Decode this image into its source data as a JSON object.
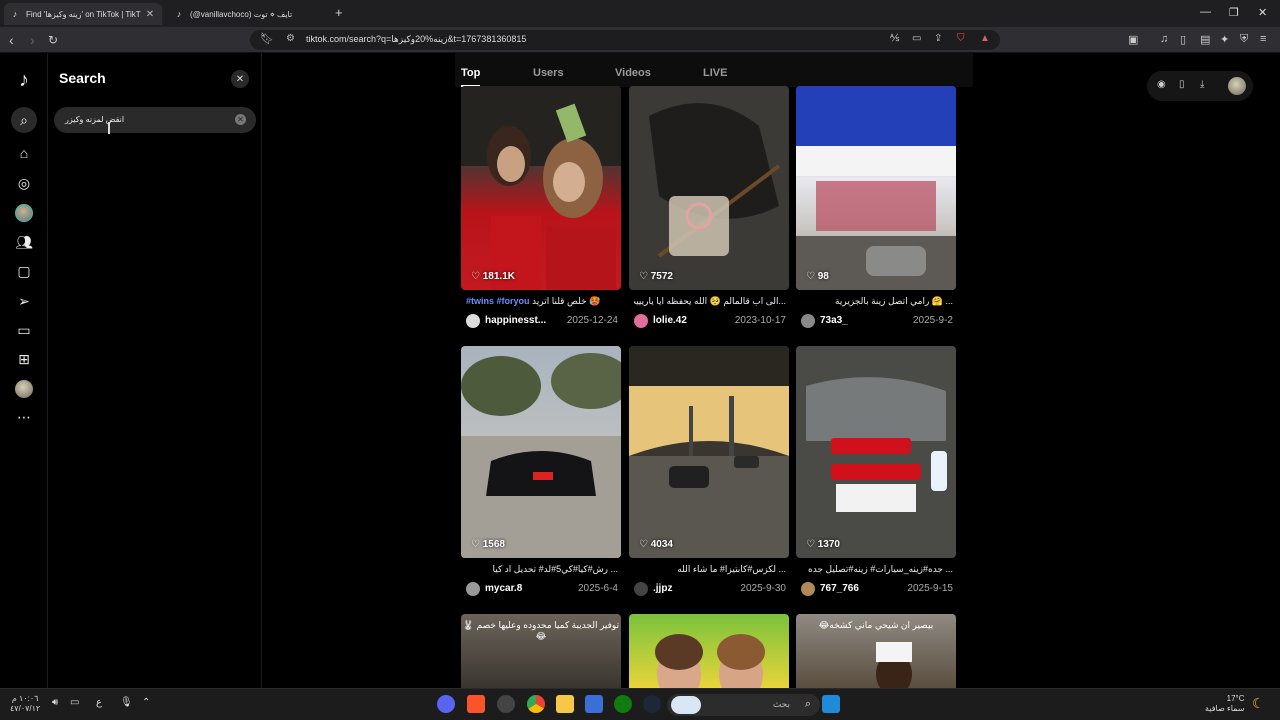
{
  "browser": {
    "tabs": [
      {
        "title": "Find 'زينه وكيزها' on TikTok | TikT",
        "active": true
      },
      {
        "title": "(@vanillavchoco) تايف ⋄ توت",
        "active": false
      }
    ],
    "url": "tiktok.com/search?q=زينه%20وكيزها&t=1767381360815"
  },
  "sidebar": {
    "logo": "TikTok",
    "icons": [
      "search-icon",
      "home-icon",
      "explore-icon",
      "avatar",
      "following-icon",
      "live-icon",
      "messages-icon",
      "activity-icon",
      "upload-icon",
      "profile-avatar",
      "more-icon"
    ]
  },
  "search_panel": {
    "title": "Search",
    "input_value": "انقض لمزنه وكيزر"
  },
  "search_tabs": [
    "Top",
    "Users",
    "Videos",
    "LIVE"
  ],
  "results": [
    {
      "likes": "181.1K",
      "desc_tag": "#twins #foryou",
      "desc_text": "خلص قلنا اتريد 🥵",
      "user": "happinesst...",
      "date": "2025-12-24",
      "thumb_style": "girls"
    },
    {
      "likes": "7572",
      "desc_tag": "",
      "desc_text": "...الى اب قالمالم 🥺 الله يحفظه ايا ياريييب\"",
      "user": "lolie.42",
      "date": "2023-10-17",
      "thumb_style": "bag"
    },
    {
      "likes": "98",
      "desc_tag": "",
      "desc_text": "... 🤗 رامي اتصل زينة بالجزيرية",
      "user": "73a3_",
      "date": "2025-9-2",
      "thumb_style": "store"
    },
    {
      "likes": "1568",
      "desc_tag": "",
      "desc_text": "... رش#كيا#كي5#لد# تحديل اد كيا",
      "user": "mycar.8",
      "date": "2025-6-4",
      "thumb_style": "car_park"
    },
    {
      "likes": "4034",
      "desc_tag": "",
      "desc_text": "... لكزس#كابتيزا# ما شاء الله",
      "user": ".jjpz",
      "date": "2025-9-30",
      "thumb_style": "highway"
    },
    {
      "likes": "1370",
      "desc_tag": "",
      "desc_text": "... جده#زينه_سيارات# زينه#تصليل جده",
      "user": "767_766",
      "date": "2025-9-15",
      "thumb_style": "garage"
    }
  ],
  "partial_results": [
    {
      "overlay_text": "توفير الجديبة كميا محدوده وعليها خصم 🐰😂"
    },
    {
      "overlay_text": ""
    },
    {
      "overlay_text": "بيصير ان شيحي ماني كشخه😂"
    }
  ],
  "taskbar": {
    "time": "١٠:٠٦ م",
    "date": "٤٧/٠٧/١٢",
    "lang": "ع",
    "search_placeholder": "بحث",
    "weather_temp": "17°C",
    "weather_desc": "سماء صافية"
  }
}
